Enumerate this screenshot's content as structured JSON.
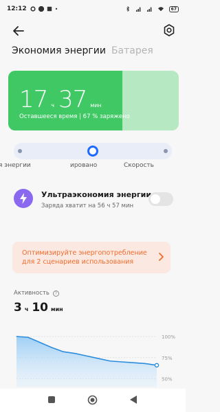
{
  "status_bar": {
    "time": "12:12",
    "battery": "67"
  },
  "tabs": [
    {
      "label": "Экономия энергии",
      "active": true
    },
    {
      "label": "Батарея",
      "active": false
    }
  ],
  "battery_card": {
    "hours": "17",
    "hours_unit": "ч",
    "minutes": "37",
    "minutes_unit": "мин",
    "remaining_text": "Оставшееся время | 67 % заряжено",
    "charge_fraction": 0.67,
    "fill_color": "#3fc864",
    "bg_color": "#b6e9c1"
  },
  "modes": {
    "labels": [
      "я энергии",
      "ировано",
      "Скорость"
    ],
    "selected_index": 1,
    "accent": "#1f6bff"
  },
  "ultra_saving": {
    "title": "Ультраэкономия энергии",
    "subtitle": "Заряда хватит на 56 ч 57 мин",
    "enabled": false
  },
  "optimize": {
    "text": "Оптимизируйте энергопотребление для 2 сценариев использования",
    "color": "#f16a2c"
  },
  "activity": {
    "label": "Активность",
    "hours": "3",
    "hours_unit": "ч",
    "minutes": "10",
    "minutes_unit": "мин"
  },
  "chart_data": {
    "type": "area",
    "x": [
      0,
      1,
      2,
      3,
      4,
      5,
      6,
      7,
      8,
      9,
      10,
      11,
      12
    ],
    "values": [
      100,
      99,
      93,
      87,
      82,
      80,
      77,
      74,
      71,
      70,
      69,
      68,
      66
    ],
    "y_tick_labels": [
      "100%",
      "75%",
      "50%"
    ],
    "y_ticks": [
      100,
      75,
      50
    ],
    "ylim": [
      40,
      100
    ],
    "color": "#2b8cdd",
    "grid": true
  },
  "nav_bar": {
    "buttons": [
      "recents",
      "home",
      "back"
    ]
  }
}
